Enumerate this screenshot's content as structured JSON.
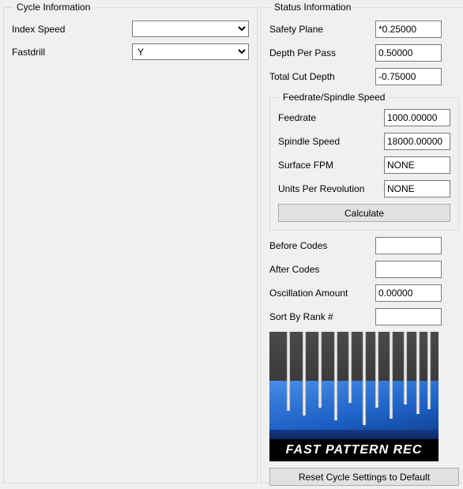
{
  "cycle": {
    "legend": "Cycle Information",
    "index_speed": {
      "label": "Index Speed",
      "value": ""
    },
    "fastdrill": {
      "label": "Fastdrill",
      "value": "Y"
    }
  },
  "status": {
    "legend": "Status Information",
    "safety_plane": {
      "label": "Safety Plane",
      "value": "*0.25000"
    },
    "depth_per_pass": {
      "label": "Depth Per Pass",
      "value": "0.50000"
    },
    "total_cut_depth": {
      "label": "Total Cut Depth",
      "value": "-0.75000"
    },
    "feed_group": {
      "legend": "Feedrate/Spindle Speed",
      "feedrate": {
        "label": "Feedrate",
        "value": "1000.00000"
      },
      "spindle_speed": {
        "label": "Spindle Speed",
        "value": "18000.00000"
      },
      "surface_fpm": {
        "label": "Surface FPM",
        "value": "NONE"
      },
      "units_per_rev": {
        "label": "Units Per Revolution",
        "value": "NONE"
      },
      "calculate_label": "Calculate"
    },
    "before_codes": {
      "label": "Before Codes",
      "value": ""
    },
    "after_codes": {
      "label": "After Codes",
      "value": ""
    },
    "oscillation_amount": {
      "label": "Oscillation Amount",
      "value": "0.00000"
    },
    "sort_by_rank": {
      "label": "Sort By Rank #",
      "value": ""
    },
    "preview_caption": "FAST PATTERN REC",
    "reset_label": "Reset Cycle Settings to Default"
  }
}
